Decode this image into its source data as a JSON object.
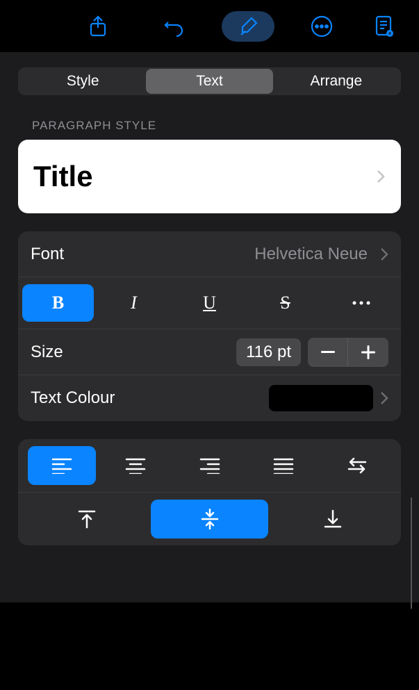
{
  "toolbar": {
    "share": "share-icon",
    "undo": "undo-icon",
    "format": "format-brush-icon",
    "more": "more-icon",
    "document": "document-icon"
  },
  "tabs": {
    "style": "Style",
    "text": "Text",
    "arrange": "Arrange",
    "selected": "Text"
  },
  "sections": {
    "paragraph_style_header": "PARAGRAPH STYLE"
  },
  "paragraph_style": {
    "current": "Title"
  },
  "font": {
    "label": "Font",
    "value": "Helvetica Neue"
  },
  "style_buttons": {
    "bold": "B",
    "italic": "I",
    "underline": "U",
    "strike": "S",
    "bold_on": true
  },
  "size": {
    "label": "Size",
    "value": "116 pt"
  },
  "text_colour": {
    "label": "Text Colour",
    "value_hex": "#000000"
  },
  "h_align": {
    "selected": "left"
  },
  "v_align": {
    "selected": "middle"
  }
}
